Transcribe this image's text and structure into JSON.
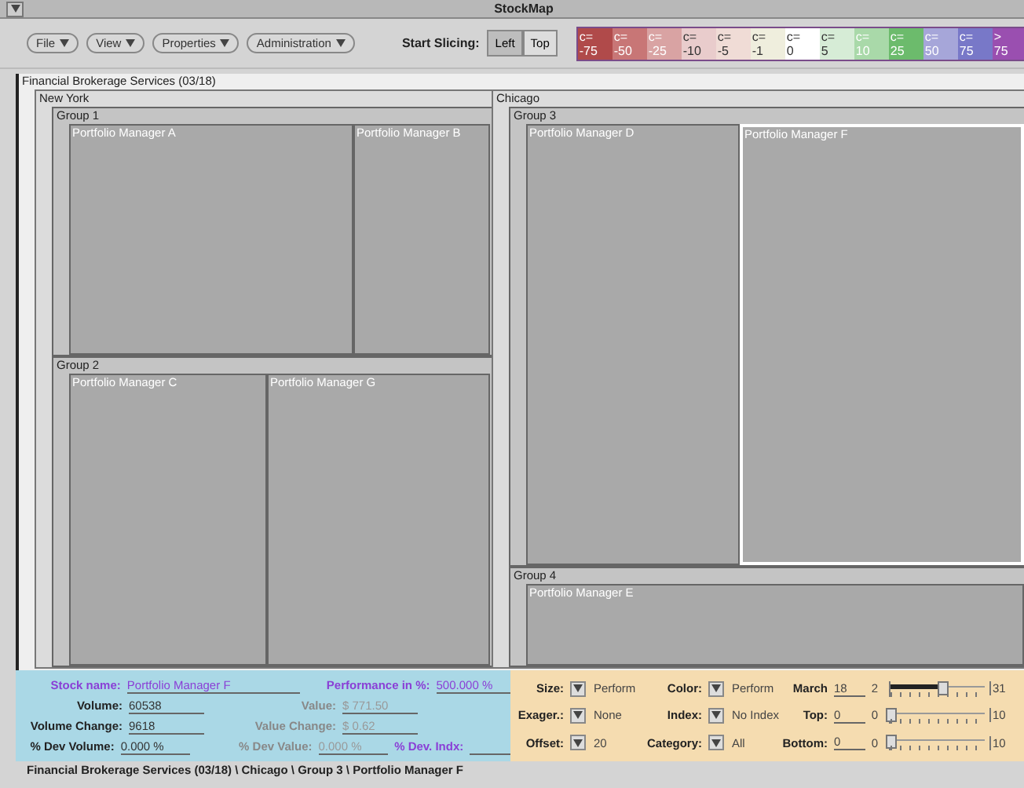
{
  "window": {
    "title": "StockMap"
  },
  "toolbar": {
    "menus": [
      {
        "label": "File"
      },
      {
        "label": "View"
      },
      {
        "label": "Properties"
      },
      {
        "label": "Administration"
      }
    ],
    "slicing": {
      "label": "Start Slicing:",
      "options": [
        {
          "label": "Left",
          "selected": true
        },
        {
          "label": "Top",
          "selected": false
        }
      ]
    }
  },
  "legend": [
    {
      "op": "c=",
      "value": "-75",
      "color": "#b04a4a"
    },
    {
      "op": "c=",
      "value": "-50",
      "color": "#c87676"
    },
    {
      "op": "c=",
      "value": "-25",
      "color": "#d9a3a3"
    },
    {
      "op": "c=",
      "value": "-10",
      "color": "#e9cccc"
    },
    {
      "op": "c=",
      "value": "-5",
      "color": "#f0dcd6"
    },
    {
      "op": "c=",
      "value": "-1",
      "color": "#efeedd"
    },
    {
      "op": "c=",
      "value": "0",
      "color": "#ffffff"
    },
    {
      "op": "c=",
      "value": "5",
      "color": "#d6ecd6"
    },
    {
      "op": "c=",
      "value": "10",
      "color": "#a9d9a9"
    },
    {
      "op": "c=",
      "value": "25",
      "color": "#6cbb6c"
    },
    {
      "op": "c=",
      "value": "50",
      "color": "#a6a6d9"
    },
    {
      "op": "c=",
      "value": "75",
      "color": "#7878c8"
    },
    {
      "op": ">",
      "value": "75",
      "color": "#9a4fb0"
    }
  ],
  "treemap": {
    "title": "Financial Brokerage Services (03/18)",
    "regions": [
      {
        "name": "New York",
        "groups": [
          {
            "name": "Group 1",
            "managers": [
              {
                "name": "Portfolio Manager A",
                "selected": false
              },
              {
                "name": "Portfolio Manager B",
                "selected": false
              }
            ]
          },
          {
            "name": "Group 2",
            "managers": [
              {
                "name": "Portfolio Manager C",
                "selected": false
              },
              {
                "name": "Portfolio Manager G",
                "selected": false
              }
            ]
          }
        ]
      },
      {
        "name": "Chicago",
        "groups": [
          {
            "name": "Group 3",
            "managers": [
              {
                "name": "Portfolio Manager D",
                "selected": false
              },
              {
                "name": "Portfolio Manager F",
                "selected": true
              }
            ]
          },
          {
            "name": "Group 4",
            "managers": [
              {
                "name": "Portfolio Manager E",
                "selected": false
              }
            ]
          }
        ]
      }
    ]
  },
  "info": [
    [
      {
        "label": "Stock name:",
        "value": "Portfolio Manager F",
        "kind": "accent"
      },
      {
        "label": "Performance in %:",
        "value": "500.000 %",
        "kind": "accent"
      }
    ],
    [
      {
        "label": "Volume:",
        "value": "60538",
        "kind": "normal"
      },
      {
        "label": "Value:",
        "value": "$ 771.50",
        "kind": "disabled"
      }
    ],
    [
      {
        "label": "Volume Change:",
        "value": "9618",
        "kind": "normal"
      },
      {
        "label": "Value Change:",
        "value": "$ 0.62",
        "kind": "disabled"
      }
    ],
    [
      {
        "label": "% Dev Volume:",
        "value": "0.000 %",
        "kind": "normal"
      },
      {
        "label": "% Dev Value:",
        "value": "0.000 %",
        "kind": "disabled"
      },
      {
        "label": "% Dev. Indx:",
        "kind": "accent"
      }
    ]
  ],
  "controls": [
    {
      "a": {
        "label": "Size:",
        "value": "Perform"
      },
      "b": {
        "label": "Color:",
        "value": "Perform"
      },
      "c": {
        "label": "March",
        "value": "18",
        "min": "2",
        "max": "31",
        "level": 0.55
      }
    },
    {
      "a": {
        "label": "Exager.:",
        "value": "None"
      },
      "b": {
        "label": "Index:",
        "value": "No Index"
      },
      "c": {
        "label": "Top:",
        "value": "0",
        "min": "0",
        "max": "10",
        "level": 0
      }
    },
    {
      "a": {
        "label": "Offset:",
        "value": "20"
      },
      "b": {
        "label": "Category:",
        "value": "All"
      },
      "c": {
        "label": "Bottom:",
        "value": "0",
        "min": "0",
        "max": "10",
        "level": 0
      }
    }
  ],
  "status_bar": "Financial Brokerage Services (03/18) \\ Chicago \\ Group 3 \\ Portfolio Manager F"
}
